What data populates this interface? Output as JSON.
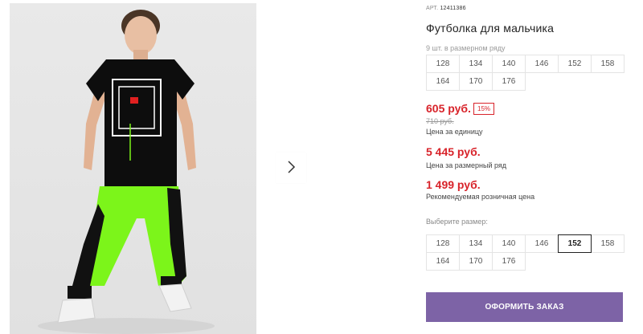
{
  "product": {
    "article_prefix": "АРТ.",
    "article": "12411386",
    "title": "Футболка для мальчика",
    "photo_alt": "boy-in-black-tshirt-and-green-pants"
  },
  "pack": {
    "label": "9 шт. в размерном ряду",
    "sizes": [
      "128",
      "134",
      "140",
      "146",
      "152",
      "158",
      "164",
      "170",
      "176"
    ]
  },
  "prices": {
    "unit_price": "605 руб.",
    "discount": "15%",
    "old_price": "710 руб.",
    "unit_note": "Цена за единицу",
    "row_price": "5 445 руб.",
    "row_note": "Цена за размерный ряд",
    "rrp_price": "1 499 руб.",
    "rrp_note": "Рекомендуемая розничная цена"
  },
  "choose": {
    "label": "Выберите размер:",
    "sizes": [
      "128",
      "134",
      "140",
      "146",
      "152",
      "158",
      "164",
      "170",
      "176"
    ],
    "selected": "152"
  },
  "actions": {
    "order_label": "ОФОРМИТЬ ЗАКАЗ"
  },
  "colors": {
    "accent_red": "#d8232a",
    "button_purple": "#7d63a6",
    "neon_green": "#7cf51a"
  },
  "icons": {
    "next": "chevron-right-icon"
  }
}
